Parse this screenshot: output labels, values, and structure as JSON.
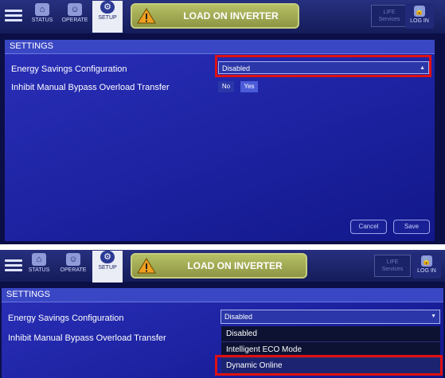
{
  "nav": {
    "status_label": "STATUS",
    "operate_label": "OPERATE",
    "setup_label": "SETUP"
  },
  "alarm": {
    "text": "LOAD ON INVERTER"
  },
  "life_services": {
    "line1": "LIFE",
    "line2": "Services"
  },
  "login_label": "LOG IN",
  "settings": {
    "header": "SETTINGS",
    "energy_label": "Energy Savings Configuration",
    "energy_value": "Disabled",
    "inhibit_label": "Inhibit Manual Bypass Overload Transfer",
    "inhibit_no": "No",
    "inhibit_yes": "Yes",
    "inhibit_selected": "Yes",
    "cancel_label": "Cancel",
    "save_label": "Save"
  },
  "dropdown_options": [
    "Disabled",
    "Intelligent ECO Mode",
    "Dynamic Online"
  ],
  "colors": {
    "panel": "#1c22a0",
    "panel_header": "#3a47c4",
    "alarm": "#a4ad56",
    "highlight": "#e01010"
  },
  "icons": {
    "menu": "hamburger-icon",
    "status": "home-icon",
    "operate": "operator-icon",
    "setup": "gear-icon",
    "alarm": "warning-icon",
    "login": "lock-icon"
  }
}
